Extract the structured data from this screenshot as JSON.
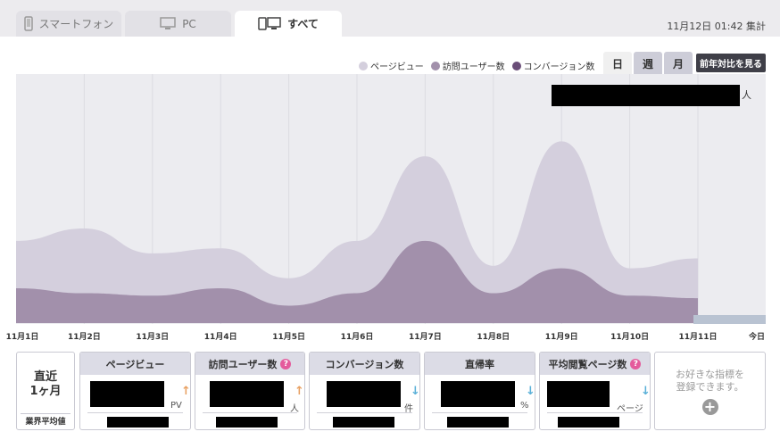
{
  "tabs": [
    {
      "label": "スマートフォン",
      "icon": "smartphone-icon",
      "active": false
    },
    {
      "label": "PC",
      "icon": "monitor-icon",
      "active": false
    },
    {
      "label": "すべて",
      "icon": "all-devices-icon",
      "active": true
    }
  ],
  "timestamp": "11月12日 01:42 集計",
  "legend": [
    {
      "label": "ページビュー",
      "color": "#d4cfdd"
    },
    {
      "label": "訪問ユーザー数",
      "color": "#a290ab"
    },
    {
      "label": "コンバージョン数",
      "color": "#6a4e78"
    }
  ],
  "period_buttons": [
    {
      "label": "日",
      "selected": true
    },
    {
      "label": "週",
      "selected": false
    },
    {
      "label": "月",
      "selected": false
    }
  ],
  "yoy_button": "前年対比を見る",
  "chart_unit": "人",
  "chart_data": {
    "type": "area",
    "categories": [
      "11月1日",
      "11月2日",
      "11月3日",
      "11月4日",
      "11月5日",
      "11月6日",
      "11月7日",
      "11月8日",
      "11月9日",
      "11月10日",
      "11月11日",
      "今日"
    ],
    "series": [
      {
        "name": "ページビュー",
        "values": [
          33,
          38,
          28,
          30,
          18,
          33,
          67,
          23,
          73,
          22,
          26,
          null
        ]
      },
      {
        "name": "訪問ユーザー数",
        "values": [
          14,
          12,
          11,
          14,
          7,
          12,
          33,
          12,
          22,
          11,
          10,
          null
        ]
      }
    ],
    "ylim": [
      0,
      100
    ]
  },
  "period_label": "直近\n1ヶ月",
  "industry_label": "業界平均値",
  "metrics": [
    {
      "title": "ページビュー",
      "help": false,
      "unit": "PV",
      "trend": "↑",
      "trend_color": "#e8a062"
    },
    {
      "title": "訪問ユーザー数",
      "help": true,
      "unit": "人",
      "trend": "↑",
      "trend_color": "#e8a062"
    },
    {
      "title": "コンバージョン数",
      "help": false,
      "unit": "件",
      "trend": "↓",
      "trend_color": "#5ab0d8"
    },
    {
      "title": "直帰率",
      "help": false,
      "unit": "%",
      "trend": "↓",
      "trend_color": "#5ab0d8"
    },
    {
      "title": "平均閲覧ページ数",
      "help": true,
      "unit": "ページ",
      "trend": "↓",
      "trend_color": "#5ab0d8"
    }
  ],
  "help_mark": "?",
  "add_metric_text": "お好きな指標を\n登録できます。",
  "add_symbol": "+"
}
